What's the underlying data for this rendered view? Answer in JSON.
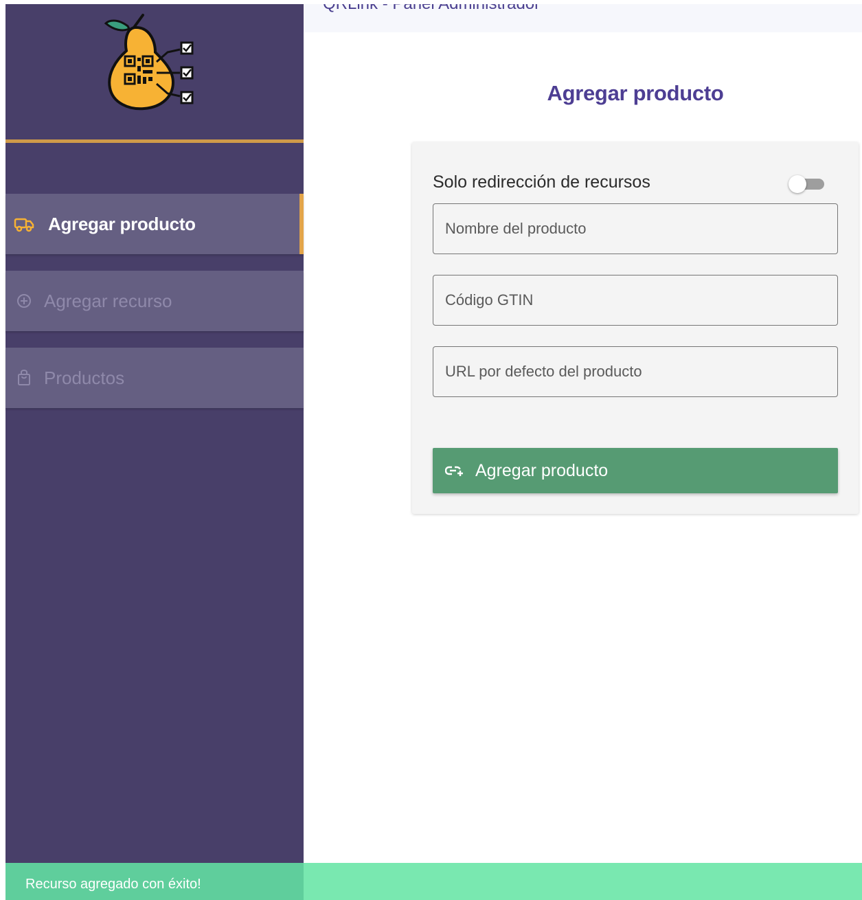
{
  "topbar": {
    "title": "QRLink - Panel Administrador"
  },
  "sidebar": {
    "logo_icon": "pear-qr-logo-icon",
    "items": [
      {
        "label": "Agregar producto",
        "icon": "truck-icon",
        "active": true
      },
      {
        "label": "Agregar recurso",
        "icon": "plus-circle-icon",
        "active": false
      },
      {
        "label": "Productos",
        "icon": "shopping-bag-icon",
        "active": false
      }
    ]
  },
  "main": {
    "title": "Agregar producto",
    "form": {
      "toggle_label": "Solo redirección de recursos",
      "toggle_on": false,
      "fields": [
        {
          "placeholder": "Nombre del producto",
          "value": ""
        },
        {
          "placeholder": "Código GTIN",
          "value": ""
        },
        {
          "placeholder": "URL por defecto del producto",
          "value": ""
        }
      ],
      "submit_label": "Agregar producto",
      "submit_icon": "add-link-icon"
    }
  },
  "snackbar": {
    "message": "Recurso agregado con éxito!"
  },
  "colors": {
    "sidebar_bg": "#483f69",
    "nav_item_bg": "#655f82",
    "accent_orange": "#e3a54a",
    "title_purple": "#4d3e93",
    "button_green": "#569b73",
    "snackbar_green": "#79e8b0"
  }
}
